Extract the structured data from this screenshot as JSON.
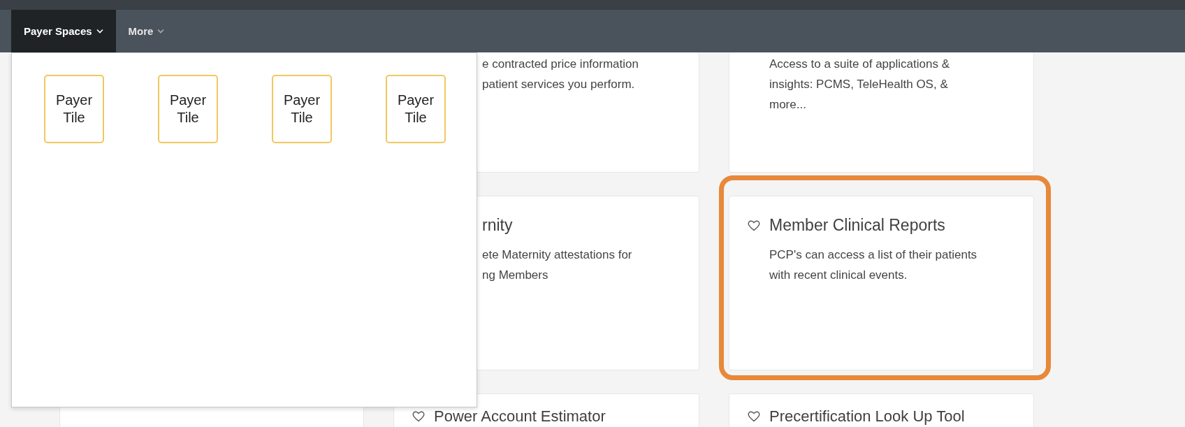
{
  "nav": {
    "tabs": [
      {
        "label": "Payer Spaces",
        "selected": true
      },
      {
        "label": "More",
        "selected": false
      }
    ]
  },
  "dropdown": {
    "tiles": [
      "Payer Tile",
      "Payer Tile",
      "Payer Tile",
      "Payer Tile"
    ]
  },
  "rows": [
    {
      "cards": [
        {
          "kind": "covered",
          "lines": [
            "e contracted price information",
            "patient services you perform."
          ]
        },
        {
          "kind": "full",
          "lines": [
            "Access to a suite of applications &",
            "insights: PCMS, TeleHealth OS, &",
            "more..."
          ]
        }
      ]
    },
    {
      "cards": [
        {
          "kind": "covered",
          "title": "rnity",
          "lines": [
            "ete Maternity attestations for",
            "ng Members"
          ]
        },
        {
          "kind": "full",
          "title": "Member Clinical Reports",
          "lines": [
            "PCP's can access a list of their patients",
            "with recent clinical events."
          ],
          "highlighted": true
        }
      ]
    },
    {
      "cards": [
        {
          "kind": "blank"
        },
        {
          "kind": "full",
          "title": "Power Account Estimator"
        },
        {
          "kind": "full",
          "title": "Precertification Look Up Tool"
        }
      ]
    }
  ]
}
